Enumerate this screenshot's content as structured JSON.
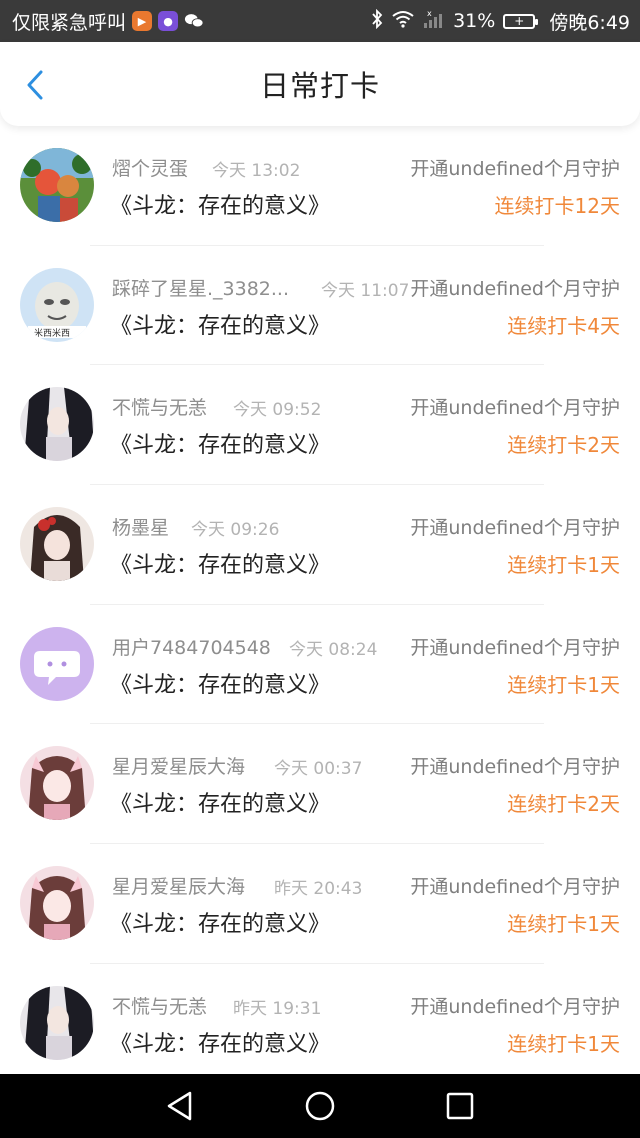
{
  "status_bar": {
    "left_text": "仅限紧急呼叫",
    "battery_percent": "31%",
    "clock": "傍晚6:49",
    "icons": [
      "video-app-icon",
      "podcast-app-icon",
      "wechat-icon",
      "bluetooth-icon",
      "wifi-icon",
      "signal-icon",
      "battery-icon"
    ]
  },
  "header": {
    "title": "日常打卡",
    "back_icon": "chevron-left-icon",
    "accent": "#2d8fe0"
  },
  "colors": {
    "streak": "#f0883a",
    "name": "#8e8e8e",
    "time": "#b3b3b3"
  },
  "checkins": [
    {
      "name": "熠个灵蛋",
      "time": "今天 13:02",
      "promo": "开通undefined个月守护",
      "book": "《斗龙：存在的意义》",
      "streak": "连续打卡12天",
      "avatar": "cartoon"
    },
    {
      "name": "踩碎了星星._3382...",
      "time": "今天 11:07",
      "promo": "开通undefined个月守护",
      "book": "《斗龙：存在的意义》",
      "streak": "连续打卡4天",
      "avatar": "meme"
    },
    {
      "name": "不慌与无恙",
      "time": "今天 09:52",
      "promo": "开通undefined个月守护",
      "book": "《斗龙：存在的意义》",
      "streak": "连续打卡2天",
      "avatar": "dark-anime"
    },
    {
      "name": "杨墨星",
      "time": "今天 09:26",
      "promo": "开通undefined个月守护",
      "book": "《斗龙：存在的意义》",
      "streak": "连续打卡1天",
      "avatar": "red-anime"
    },
    {
      "name": "用户7484704548",
      "time": "今天 08:24",
      "promo": "开通undefined个月守护",
      "book": "《斗龙：存在的意义》",
      "streak": "连续打卡1天",
      "avatar": "default-chat"
    },
    {
      "name": "星月爱星辰大海",
      "time": "今天 00:37",
      "promo": "开通undefined个月守护",
      "book": "《斗龙：存在的意义》",
      "streak": "连续打卡2天",
      "avatar": "pink-anime"
    },
    {
      "name": "星月爱星辰大海",
      "time": "昨天 20:43",
      "promo": "开通undefined个月守护",
      "book": "《斗龙：存在的意义》",
      "streak": "连续打卡1天",
      "avatar": "pink-anime"
    },
    {
      "name": "不慌与无恙",
      "time": "昨天 19:31",
      "promo": "开通undefined个月守护",
      "book": "《斗龙：存在的意义》",
      "streak": "连续打卡1天",
      "avatar": "dark-anime"
    }
  ],
  "nav_bar": {
    "buttons": [
      "back-triangle-icon",
      "home-circle-icon",
      "recents-square-icon"
    ]
  }
}
